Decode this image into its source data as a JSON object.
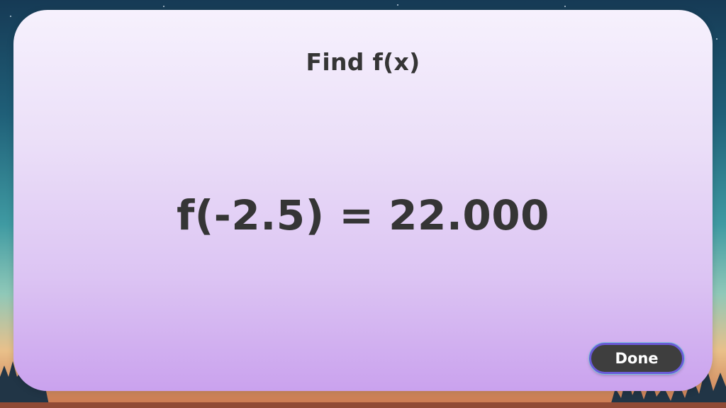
{
  "dialog": {
    "title": "Find f(x)",
    "result_text": "f(-2.5) = 22.000",
    "done_label": "Done"
  },
  "colors": {
    "panel_top": "#f6f1fd",
    "panel_bottom": "#caa2ee",
    "text": "#353535",
    "button_bg": "#3e3e3e",
    "button_border": "#6a5ad8"
  }
}
